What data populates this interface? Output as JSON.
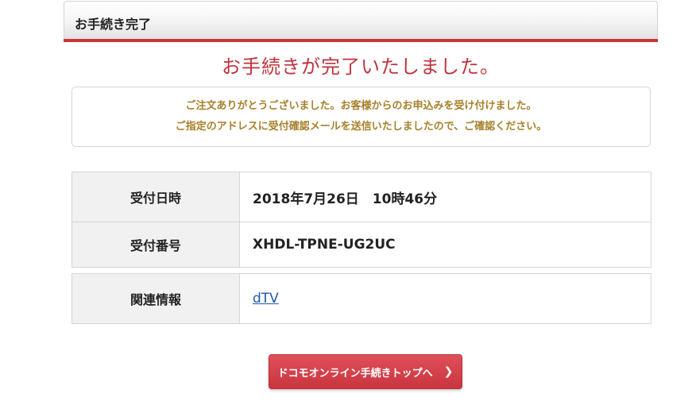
{
  "header": {
    "title": "お手続き完了"
  },
  "main": {
    "heading": "お手続きが完了いたしました。",
    "notice_lines": [
      "ご注文ありがとうございました。お客様からのお申込みを受け付けました。",
      "ご指定のアドレスに受付確認メールを送信いたしましたので、ご確認ください。"
    ]
  },
  "info_table": [
    {
      "label": "受付日時",
      "value": "2018年7月26日　10時46分"
    },
    {
      "label": "受付番号",
      "value": "XHDL-TPNE-UG2UC"
    }
  ],
  "related": {
    "label": "関連情報",
    "link_text": "dTV"
  },
  "cta": {
    "label": "ドコモオンライン手続きトップへ",
    "icon": "chevron-right-icon"
  },
  "colors": {
    "accent_red": "#c8353c",
    "heading_red": "#c0333d",
    "notice_gold": "#a7802a",
    "link_blue": "#1f5aa6"
  }
}
